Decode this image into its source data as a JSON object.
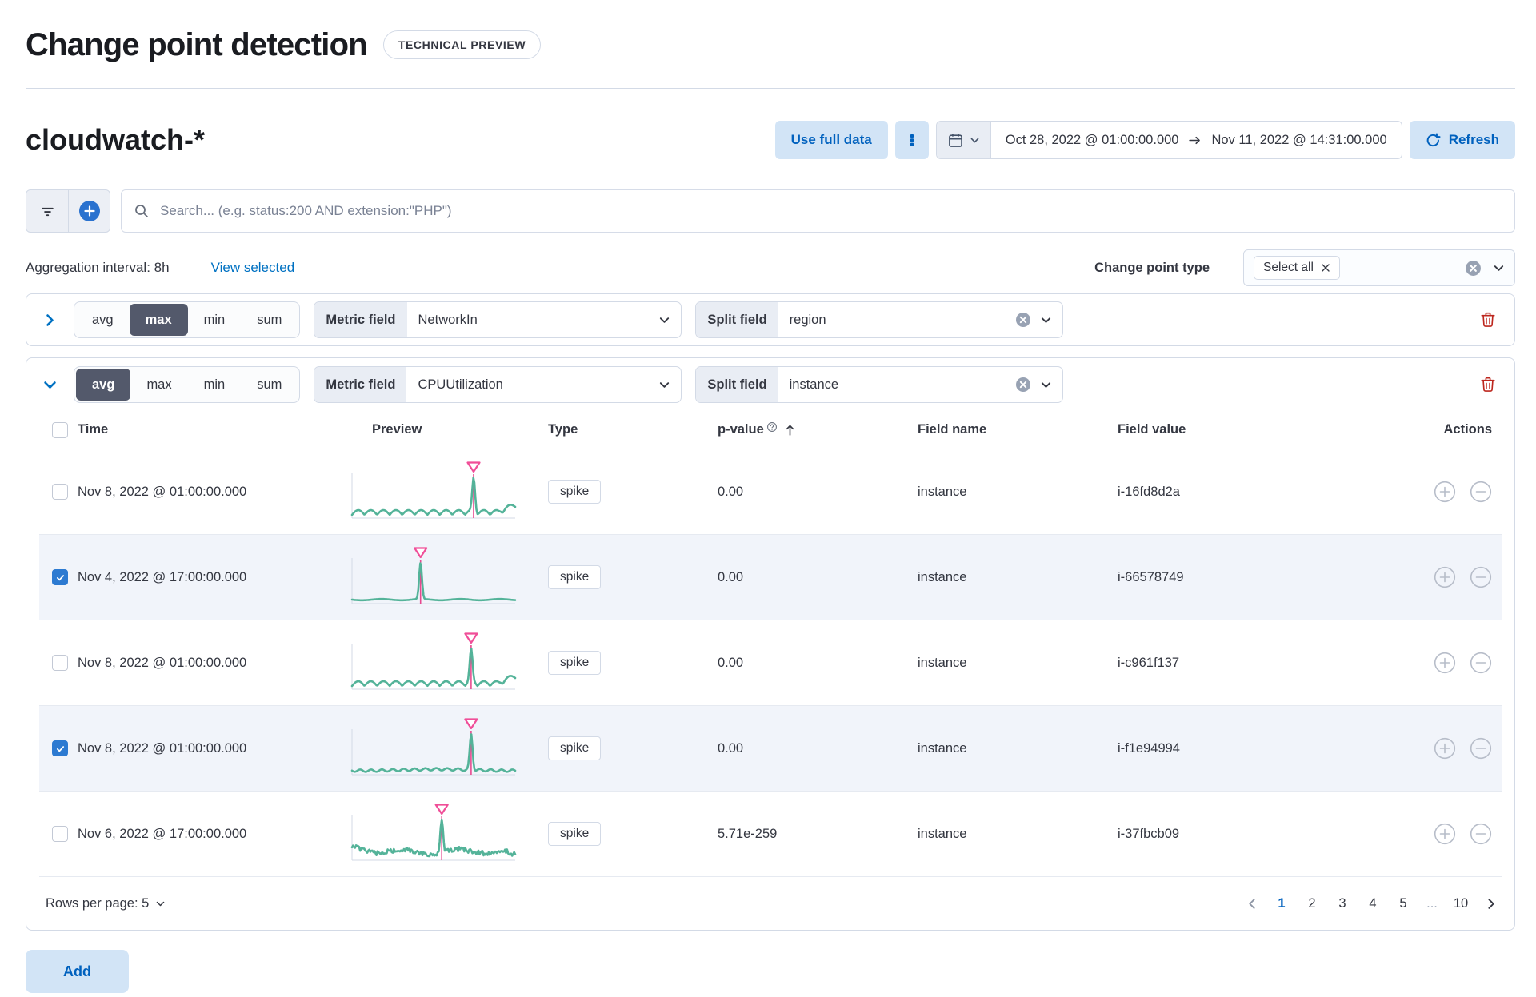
{
  "header": {
    "title": "Change point detection",
    "badge": "TECHNICAL PREVIEW"
  },
  "toolbar": {
    "index_pattern": "cloudwatch-*",
    "use_full_data": "Use full data",
    "date_start": "Oct 28, 2022 @ 01:00:00.000",
    "date_end": "Nov 11, 2022 @ 14:31:00.000",
    "refresh": "Refresh"
  },
  "search": {
    "placeholder": "Search... (e.g. status:200 AND extension:\"PHP\")"
  },
  "filters": {
    "aggregation_interval": "Aggregation interval: 8h",
    "view_selected": "View selected",
    "change_point_type_label": "Change point type",
    "change_point_type_selected": "Select all"
  },
  "configs": [
    {
      "agg_options": [
        "avg",
        "max",
        "min",
        "sum"
      ],
      "selected_agg": "max",
      "metric_label": "Metric field",
      "metric_value": "NetworkIn",
      "split_label": "Split field",
      "split_value": "region",
      "expanded": false
    },
    {
      "agg_options": [
        "avg",
        "max",
        "min",
        "sum"
      ],
      "selected_agg": "avg",
      "metric_label": "Metric field",
      "metric_value": "CPUUtilization",
      "split_label": "Split field",
      "split_value": "instance",
      "expanded": true
    }
  ],
  "table": {
    "columns": [
      "Time",
      "Preview",
      "Type",
      "p-value",
      "Field name",
      "Field value",
      "Actions"
    ],
    "rows": [
      {
        "checked": false,
        "time": "Nov 8, 2022 @ 01:00:00.000",
        "type": "spike",
        "p_value": "0.00",
        "field_name": "instance",
        "field_value": "i-16fd8d2a",
        "preview": {
          "pattern": "wave",
          "spike_x": 0.745,
          "end": "rise",
          "seed": 1
        }
      },
      {
        "checked": true,
        "time": "Nov 4, 2022 @ 17:00:00.000",
        "type": "spike",
        "p_value": "0.00",
        "field_name": "instance",
        "field_value": "i-66578749",
        "preview": {
          "pattern": "flat",
          "spike_x": 0.42,
          "end": "none",
          "seed": 2
        }
      },
      {
        "checked": false,
        "time": "Nov 8, 2022 @ 01:00:00.000",
        "type": "spike",
        "p_value": "0.00",
        "field_name": "instance",
        "field_value": "i-c961f137",
        "preview": {
          "pattern": "wave",
          "spike_x": 0.73,
          "end": "rise",
          "seed": 3
        }
      },
      {
        "checked": true,
        "time": "Nov 8, 2022 @ 01:00:00.000",
        "type": "spike",
        "p_value": "0.00",
        "field_name": "instance",
        "field_value": "i-f1e94994",
        "preview": {
          "pattern": "ripple",
          "spike_x": 0.73,
          "end": "none",
          "seed": 4
        }
      },
      {
        "checked": false,
        "time": "Nov 6, 2022 @ 17:00:00.000",
        "type": "spike",
        "p_value": "5.71e-259",
        "field_name": "instance",
        "field_value": "i-37fbcb09",
        "preview": {
          "pattern": "noisy",
          "spike_x": 0.55,
          "end": "drop",
          "seed": 5
        }
      }
    ]
  },
  "footer": {
    "rows_per_page": "Rows per page: 5",
    "pages": [
      "1",
      "2",
      "3",
      "4",
      "5"
    ],
    "ellipsis": "...",
    "last_page": "10",
    "active_page": "1"
  },
  "add_button": "Add",
  "colors": {
    "primary_blue": "#0061be",
    "link_blue": "#0071c2",
    "spark_green": "#54b399",
    "annotation_pink": "#f04e98",
    "danger_red": "#bd271e",
    "selected_row_bg": "#f1f4fa"
  }
}
